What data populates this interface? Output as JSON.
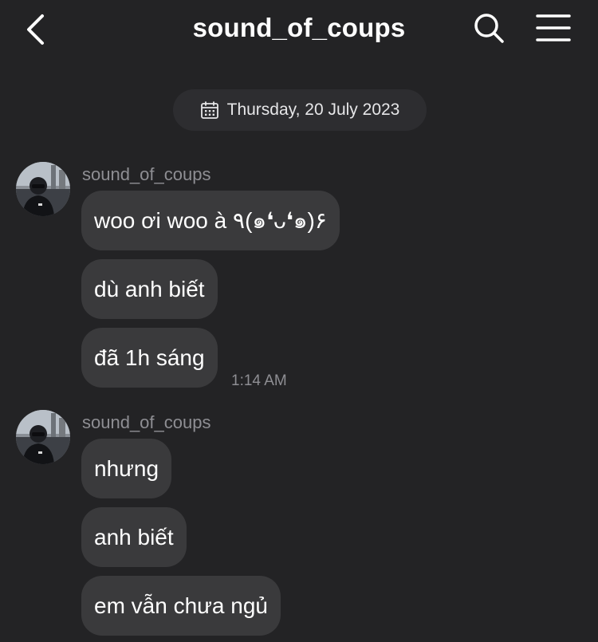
{
  "header": {
    "title": "sound_of_coups",
    "back_icon": "chevron-left-icon",
    "search_icon": "search-icon",
    "menu_icon": "hamburger-menu-icon"
  },
  "date_separator": {
    "icon": "calendar-icon",
    "text": "Thursday, 20 July 2023"
  },
  "groups": [
    {
      "sender": "sound_of_coups",
      "messages": [
        "woo ơi woo à ٩(๑❛ᴗ❛๑)۶",
        "dù anh biết",
        "đã 1h sáng"
      ],
      "time": "1:14 AM"
    },
    {
      "sender": "sound_of_coups",
      "messages": [
        "nhưng",
        "anh biết",
        "em vẫn chưa ngủ"
      ]
    }
  ],
  "colors": {
    "background": "#232325",
    "bubble": "#3a3a3c",
    "date_pill": "#2d2d30",
    "secondary_text": "#8e8e93"
  }
}
